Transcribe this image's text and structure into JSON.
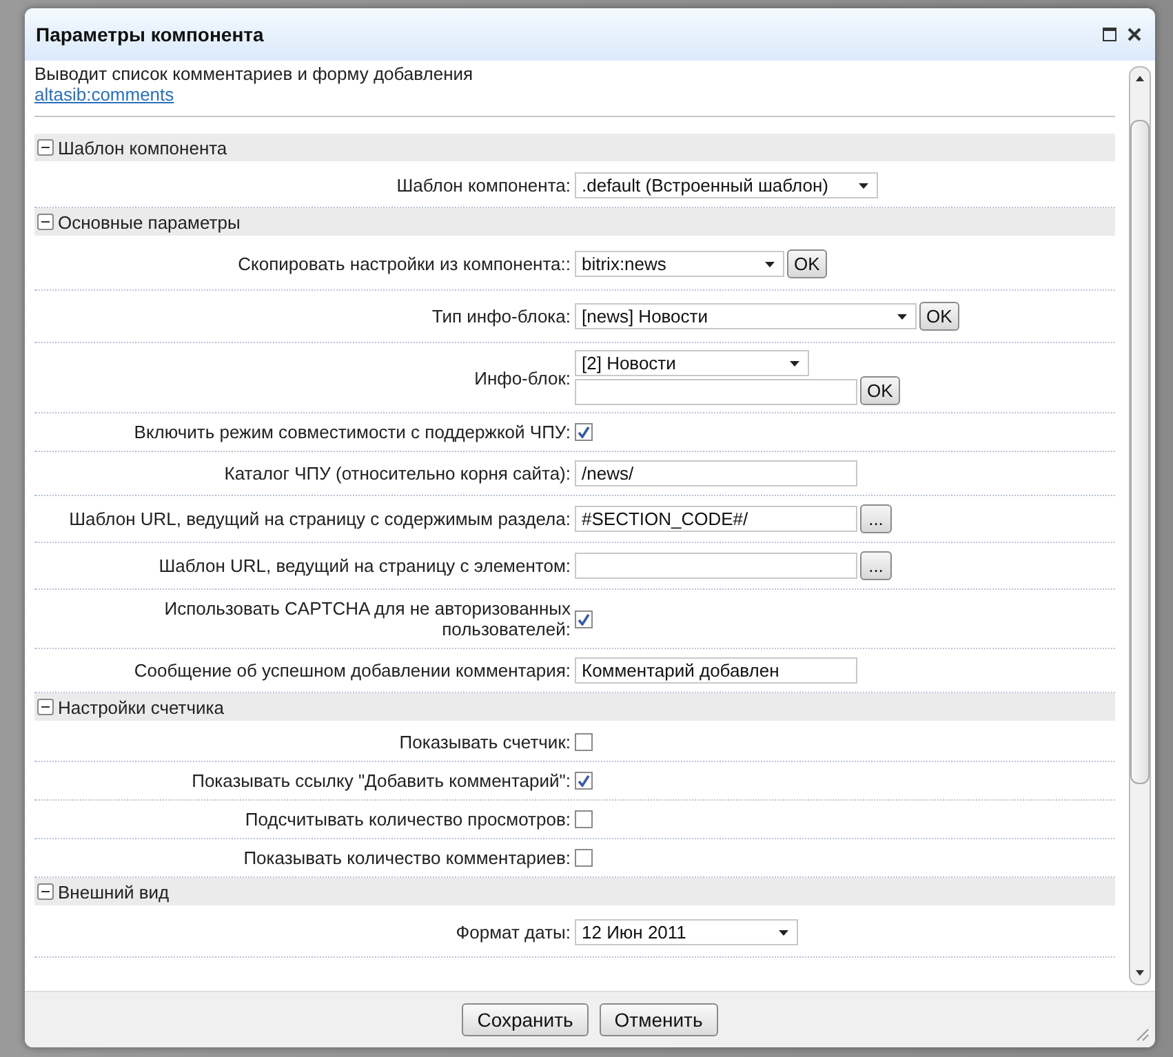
{
  "dialog": {
    "title": "Параметры компонента",
    "description": "Выводит список комментариев и форму добавления",
    "link": "altasib:comments",
    "sections": [
      {
        "title": "Шаблон компонента",
        "expanded": true,
        "rows": [
          {
            "kind": "select",
            "label": "Шаблон компонента:",
            "value": ".default (Встроенный шаблон)"
          }
        ]
      },
      {
        "title": "Основные параметры",
        "expanded": true,
        "rows": [
          {
            "kind": "select-ok",
            "label": "Скопировать настройки из компонента::",
            "value": "bitrix:news",
            "button": "OK"
          },
          {
            "kind": "select-ok-wide",
            "label": "Тип инфо-блока:",
            "value": "[news] Новости",
            "button": "OK"
          },
          {
            "kind": "select-input-ok",
            "label": "Инфо-блок:",
            "value": "[2] Новости",
            "button": "OK"
          },
          {
            "kind": "checkbox",
            "label": "Включить режим совместимости с поддержкой ЧПУ:",
            "checked": true
          },
          {
            "kind": "text",
            "label": "Каталог ЧПУ (относительно корня сайта):",
            "value": "/news/"
          },
          {
            "kind": "text-browse",
            "label": "Шаблон URL, ведущий на страницу с содержимым раздела:",
            "value": "#SECTION_CODE#/",
            "button": "..."
          },
          {
            "kind": "text-browse",
            "label": "Шаблон URL, ведущий на страницу с элементом:",
            "button": "..."
          },
          {
            "kind": "checkbox",
            "label": "Использовать CAPTCHA для не авторизованных пользователей:",
            "checked": true
          },
          {
            "kind": "text",
            "label": "Сообщение об успешном добавлении комментария:",
            "value": "Комментарий добавлен"
          }
        ]
      },
      {
        "title": "Настройки счетчика",
        "expanded": true,
        "rows": [
          {
            "kind": "checkbox",
            "label": "Показывать счетчик:",
            "checked": false
          },
          {
            "kind": "checkbox",
            "label": "Показывать ссылку \"Добавить комментарий\":",
            "checked": true
          },
          {
            "kind": "checkbox",
            "label": "Подсчитывать количество просмотров:",
            "checked": false
          },
          {
            "kind": "checkbox",
            "label": "Показывать количество комментариев:",
            "checked": false
          }
        ]
      },
      {
        "title": "Внешний вид",
        "expanded": true,
        "rows": [
          {
            "kind": "select-short",
            "label": "Формат даты:",
            "value": "12 Июн 2011"
          }
        ]
      }
    ],
    "buttons": [
      "Сохранить",
      "Отменить"
    ]
  }
}
